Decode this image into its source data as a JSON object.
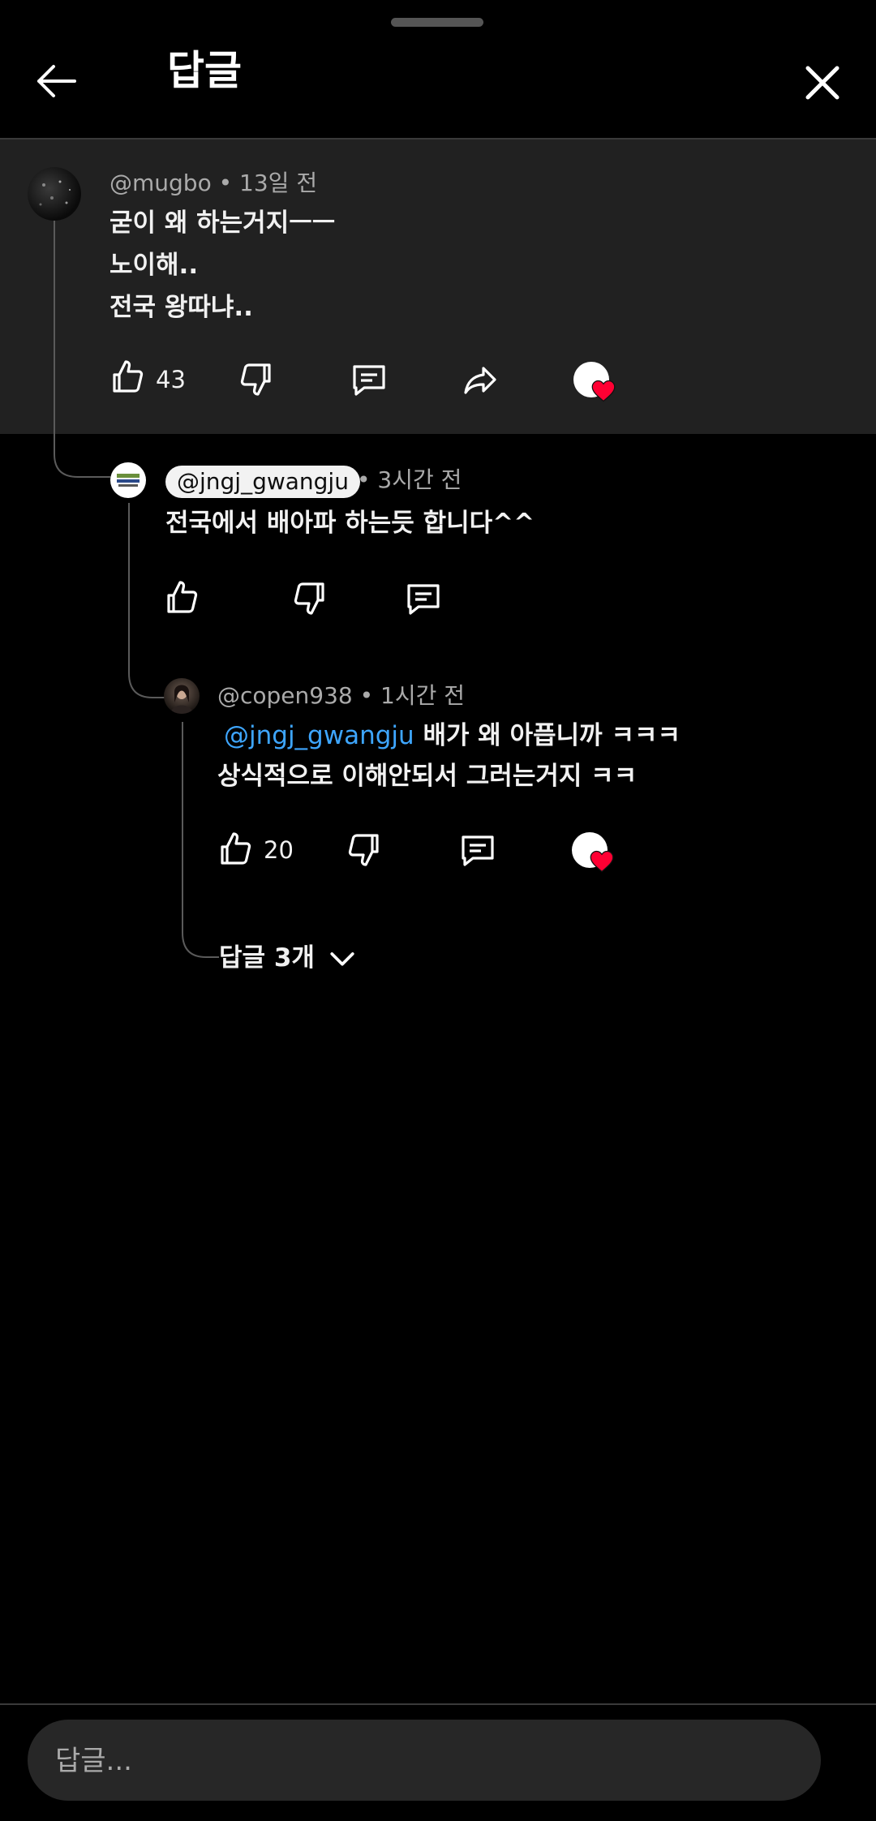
{
  "header": {
    "back_icon": "arrow-left-icon",
    "title": "답글",
    "close_icon": "close-icon"
  },
  "parent_comment": {
    "username": "@mugbo",
    "time": "• 13일 전",
    "lines": [
      "굳이 왜 하는거지ㅡㅡ",
      "노이해..",
      "전국 왕따냐.."
    ],
    "like_count": "43",
    "actions": [
      "like-icon",
      "dislike-icon",
      "reply-icon",
      "share-icon",
      "creator-heart-icon"
    ]
  },
  "replies": [
    {
      "username": "@jngj_gwangju",
      "time": "• 3시간 전",
      "lines": [
        "전국에서 배아파 하는듯 합니다^^"
      ],
      "like_count": ""
    },
    {
      "username": "@copen938",
      "time": "• 1시간 전",
      "mention": "@jngj_gwangju",
      "line1_rest": " 배가 왜 아픕니까 ㅋㅋㅋ",
      "line2": "상식적으로 이해안되서 그러는거지 ㅋㅋ",
      "like_count": "20"
    }
  ],
  "more_replies": "답글 3개",
  "composer": {
    "placeholder": "답글..."
  },
  "colors": {
    "background": "#000000",
    "parent_highlight": "#212121",
    "mention": "#3ea6ff",
    "heart": "#ff0033"
  }
}
